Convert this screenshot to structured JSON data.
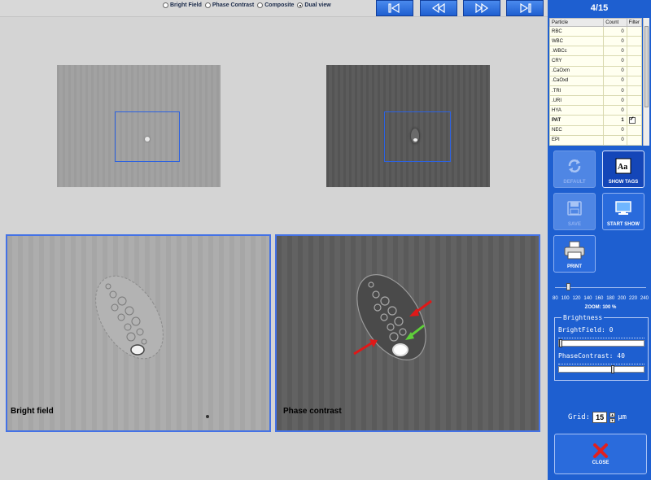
{
  "view_modes": [
    {
      "label": "Bright Field",
      "selected": false
    },
    {
      "label": "Phase Contrast",
      "selected": false
    },
    {
      "label": "Composite",
      "selected": false
    },
    {
      "label": "Dual view",
      "selected": true
    }
  ],
  "nav_buttons": [
    "first-icon",
    "previous-icon",
    "next-icon",
    "last-icon"
  ],
  "counter": "4/15",
  "particle_table": {
    "headers": [
      "Particle",
      "Count",
      "Filter"
    ],
    "rows": [
      {
        "name": "RBC",
        "count": "0",
        "filter": false
      },
      {
        "name": "WBC",
        "count": "0",
        "filter": false
      },
      {
        "name": ".WBCc",
        "count": "0",
        "filter": false
      },
      {
        "name": "CRY",
        "count": "0",
        "filter": false
      },
      {
        "name": ".CaOxm",
        "count": "0",
        "filter": false
      },
      {
        "name": ".CaOxd",
        "count": "0",
        "filter": false
      },
      {
        "name": ".TRI",
        "count": "0",
        "filter": false
      },
      {
        "name": ".URI",
        "count": "0",
        "filter": false
      },
      {
        "name": "HYA",
        "count": "0",
        "filter": false
      },
      {
        "name": "PAT",
        "count": "1",
        "filter": true,
        "bold": true
      },
      {
        "name": "NEC",
        "count": "0",
        "filter": false
      },
      {
        "name": "EPI",
        "count": "0",
        "filter": false
      }
    ]
  },
  "buttons": {
    "default": "DEFAULT",
    "show_tags": "SHOW TAGS",
    "save": "SAVE",
    "start_show": "START SHOW",
    "print": "PRINT",
    "close": "CLOSE"
  },
  "zoom": {
    "ticks": [
      "80",
      "100",
      "120",
      "140",
      "160",
      "180",
      "200",
      "220",
      "240"
    ],
    "label": "ZOOM: 100 %",
    "value": 100
  },
  "brightness": {
    "title": "Brightness",
    "brightfield_label": "BrightField: 0",
    "brightfield_value": 0,
    "phasecontrast_label": "PhaseContrast: 40",
    "phasecontrast_value": 40
  },
  "grid": {
    "label": "Grid:",
    "value": "15",
    "unit": "µm"
  },
  "panels": {
    "left_label": "Bright field",
    "right_label": "Phase contrast"
  },
  "colors": {
    "accent": "#1e5fd0",
    "roi": "#2d62e0",
    "arrow_red": "#e01818",
    "arrow_green": "#5fcf3a"
  }
}
